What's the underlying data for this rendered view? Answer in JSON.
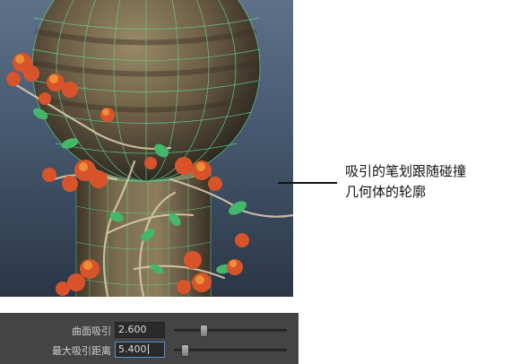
{
  "annotation": {
    "line1": "吸引的笔划跟随碰撞",
    "line2": "几何体的轮廓"
  },
  "attributes": [
    {
      "label": "曲面吸引",
      "value": "2.600",
      "slider_fraction": 0.25
    },
    {
      "label": "最大吸引距离",
      "value": "5.400",
      "slider_fraction": 0.09
    }
  ]
}
